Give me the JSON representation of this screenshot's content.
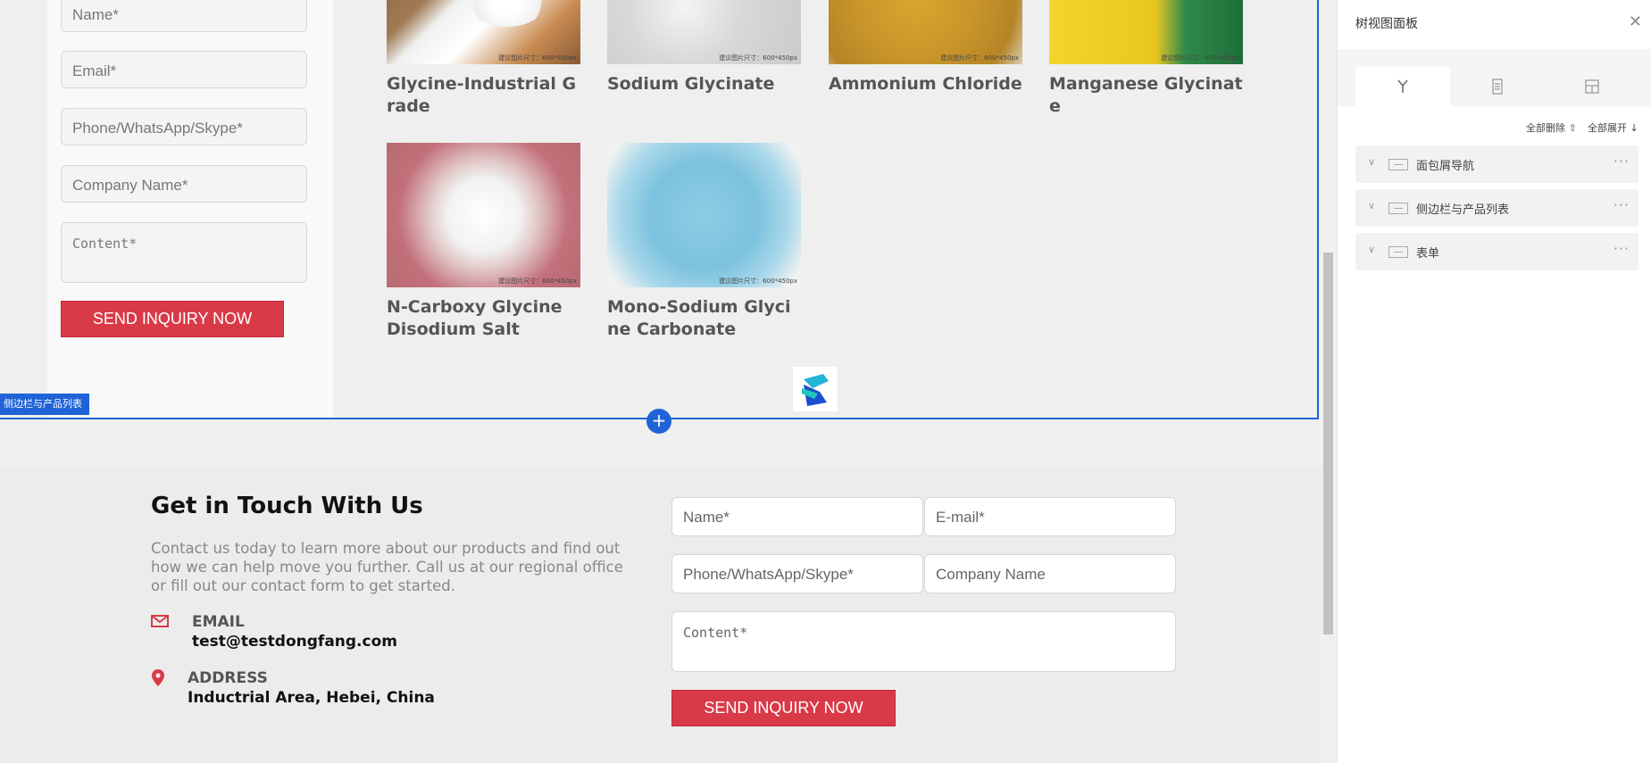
{
  "sidebar_form": {
    "name_placeholder": "Name*",
    "email_placeholder": "Email*",
    "phone_placeholder": "Phone/WhatsApp/Skype*",
    "company_placeholder": "Company Name*",
    "content_placeholder": "Content*",
    "send_label": "SEND INQUIRY NOW"
  },
  "products": [
    {
      "name": "Glycine-Industrial Grade"
    },
    {
      "name": "Sodium Glycinate"
    },
    {
      "name": "Ammonium Chloride"
    },
    {
      "name": "Manganese Glycinate"
    },
    {
      "name": "N-Carboxy Glycine Disodium Salt"
    },
    {
      "name": "Mono-Sodium Glycine Carbonate"
    }
  ],
  "selection": {
    "label": "侧边栏与产品列表",
    "add_symbol": "+"
  },
  "contact": {
    "title": "Get in Touch With Us",
    "description": "Contact us today to learn more about our products and find out how we can help move you further. Call us at our regional office or fill out our contact form to get started.",
    "email_label": "EMAIL",
    "email_value": "test@testdongfang.com",
    "address_label": "ADDRESS",
    "address_value": "Inductrial Area, Hebei, China",
    "form": {
      "name_placeholder": "Name*",
      "email_placeholder": "E-mail*",
      "phone_placeholder": "Phone/WhatsApp/Skype*",
      "company_placeholder": "Company Name",
      "content_placeholder": "Content*",
      "send_label": "SEND INQUIRY NOW"
    }
  },
  "panel": {
    "title": "树视图面板",
    "close": "✕",
    "delete_all": "全部删除",
    "expand_all": "全部展开",
    "tabs": [
      "tree-icon",
      "list-icon",
      "layout-icon"
    ],
    "items": [
      {
        "label": "面包屑导航"
      },
      {
        "label": "侧边栏与产品列表"
      },
      {
        "label": "表单"
      }
    ]
  },
  "colors": {
    "accent_blue": "#1f63d6",
    "button_red": "#d93a48"
  }
}
